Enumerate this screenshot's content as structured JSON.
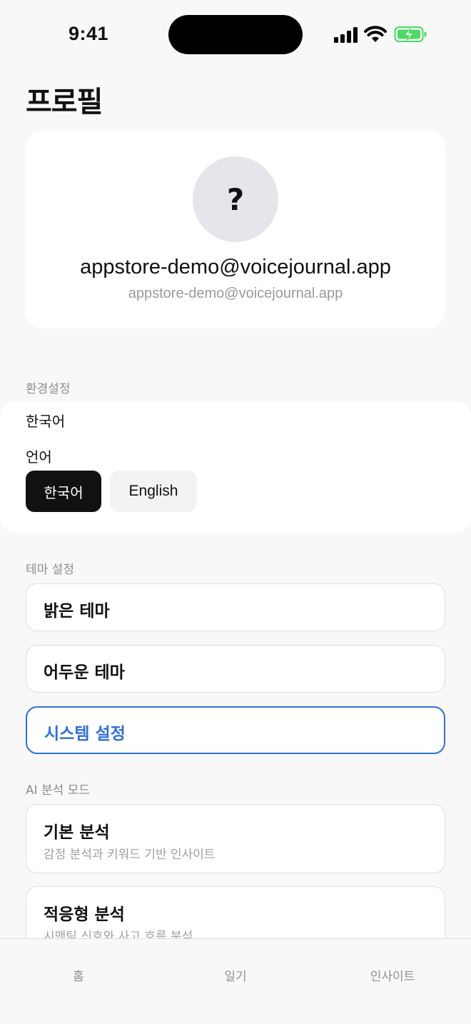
{
  "status_bar": {
    "time": "9:41"
  },
  "header": {
    "title": "프로필"
  },
  "profile": {
    "avatar_placeholder": "?",
    "display_name": "appstore-demo@voicejournal.app",
    "email": "appstore-demo@voicejournal.app"
  },
  "preferences": {
    "section_label": "환경설정",
    "current_language": "한국어",
    "language_label": "언어",
    "options": [
      {
        "label": "한국어",
        "selected": true
      },
      {
        "label": "English",
        "selected": false
      }
    ]
  },
  "theme": {
    "section_label": "테마 설정",
    "options": [
      {
        "label": "밝은 테마",
        "selected": false
      },
      {
        "label": "어두운 테마",
        "selected": false
      },
      {
        "label": "시스템 설정",
        "selected": true
      }
    ],
    "accent_color": "#2f6fd6"
  },
  "ai_mode": {
    "section_label": "AI 분석 모드",
    "options": [
      {
        "title": "기본 분석",
        "description": "감정 분석과 키워드 기반 인사이트"
      },
      {
        "title": "적응형 분석",
        "description": "시맨틱 신호와 사고 흐름 분석"
      }
    ]
  },
  "tab_bar": {
    "tabs": [
      {
        "label": "홈"
      },
      {
        "label": "일기"
      },
      {
        "label": "인사이트"
      }
    ]
  }
}
